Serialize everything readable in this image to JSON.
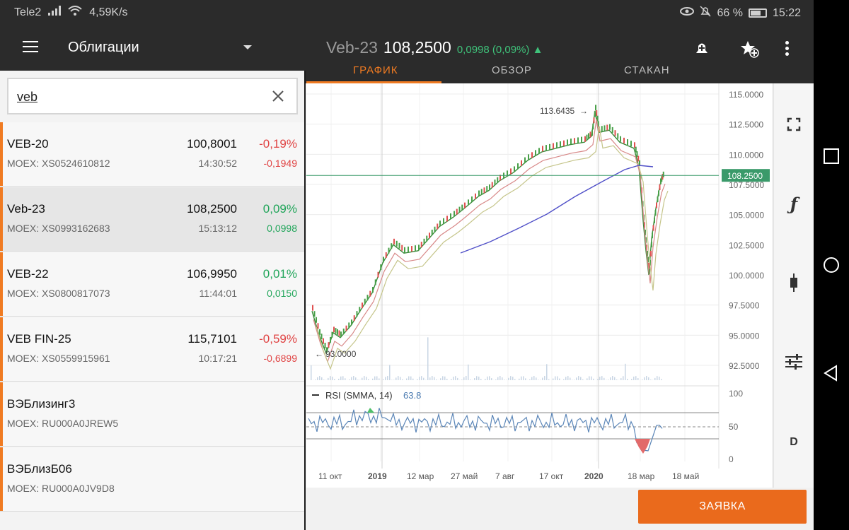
{
  "status": {
    "carrier": "Tele2",
    "speed": "4,59K/s",
    "battery": "66 %",
    "time": "15:22"
  },
  "header": {
    "menu_label": "Облигации",
    "ticker": "Veb-23",
    "price": "108,2500",
    "change": "0,0998 (0,09%) ▲",
    "tabs": [
      {
        "label": "ГРАФИК"
      },
      {
        "label": "ОБЗОР"
      },
      {
        "label": "СТАКАН"
      }
    ]
  },
  "search": {
    "value": "veb"
  },
  "list": [
    {
      "name": "VEB-20",
      "sub": "MOEX: XS0524610812",
      "price": "100,8001",
      "time": "14:30:52",
      "pct": "-0,19%",
      "chg": "-0,1949",
      "dir": "neg"
    },
    {
      "name": "Veb-23",
      "sub": "MOEX: XS0993162683",
      "price": "108,2500",
      "time": "15:13:12",
      "pct": "0,09%",
      "chg": "0,0998",
      "dir": "pos"
    },
    {
      "name": "VEB-22",
      "sub": "MOEX: XS0800817073",
      "price": "106,9950",
      "time": "11:44:01",
      "pct": "0,01%",
      "chg": "0,0150",
      "dir": "pos"
    },
    {
      "name": "VEB FIN-25",
      "sub": "MOEX: XS0559915961",
      "price": "115,7101",
      "time": "10:17:21",
      "pct": "-0,59%",
      "chg": "-0,6899",
      "dir": "neg"
    },
    {
      "name": "ВЭБлизинг3",
      "sub": "MOEX: RU000A0JREW5",
      "price": "",
      "time": "",
      "pct": "",
      "chg": "",
      "dir": ""
    },
    {
      "name": "ВЭБлизБ06",
      "sub": "MOEX: RU000A0JV9D8",
      "price": "",
      "time": "",
      "pct": "",
      "chg": "",
      "dir": ""
    }
  ],
  "chart": {
    "y_ticks": [
      "115.0000",
      "112.5000",
      "110.0000",
      "107.5000",
      "105.0000",
      "102.5000",
      "100.0000",
      "97.5000",
      "95.0000",
      "92.5000"
    ],
    "x_ticks": [
      "11 окт",
      "2019",
      "12 мар",
      "27 май",
      "7 авг",
      "17 окт",
      "2020",
      "18 мар",
      "18 май"
    ],
    "high_label": "113.6435",
    "low_label": "93.0000",
    "last_label": "108.2500",
    "rsi_label": "RSI (SMMA, 14)",
    "rsi_value": "63.8",
    "rsi_ticks": [
      "100",
      "50",
      "0"
    ]
  },
  "tools": {
    "d_label": "D"
  },
  "order_label": "ЗАЯВКА",
  "colors": {
    "accent": "#f07b22",
    "up": "#21a55a",
    "down": "#e04444"
  }
}
